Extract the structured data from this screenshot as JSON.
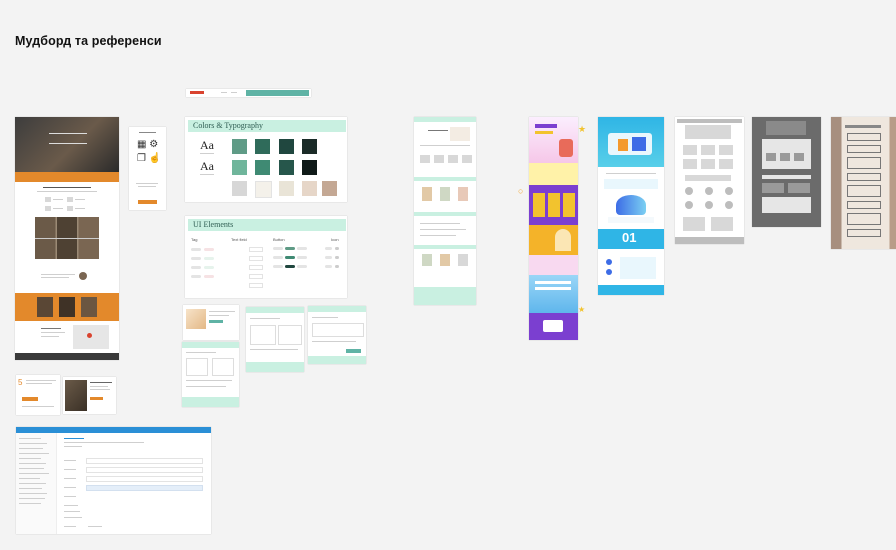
{
  "board": {
    "title": "Мудборд та референси"
  },
  "style_guide": {
    "colors_heading": "Colors & Typography",
    "ui_heading": "UI Elements",
    "type_sample_1": "Aa",
    "type_sample_2": "Aa",
    "columns": [
      "Tag",
      "Text field",
      "Button",
      "Icon"
    ],
    "swatches": [
      "#5f9b86",
      "#2f6b5a",
      "#20473f",
      "#1b2b28",
      "#6fb59b",
      "#3f8a73",
      "#26564b",
      "#0f1a18",
      "#d7d7d7",
      "#f4f1ea",
      "#e9e4d7",
      "#e6d6c8",
      "#c4a894"
    ]
  },
  "palette": {
    "orange": "#e3892b",
    "mint": "#c9f0e1",
    "purple": "#7b3fd0",
    "blue": "#2fb5e6",
    "dark": "#3a3a3a"
  },
  "hero_text": "01"
}
